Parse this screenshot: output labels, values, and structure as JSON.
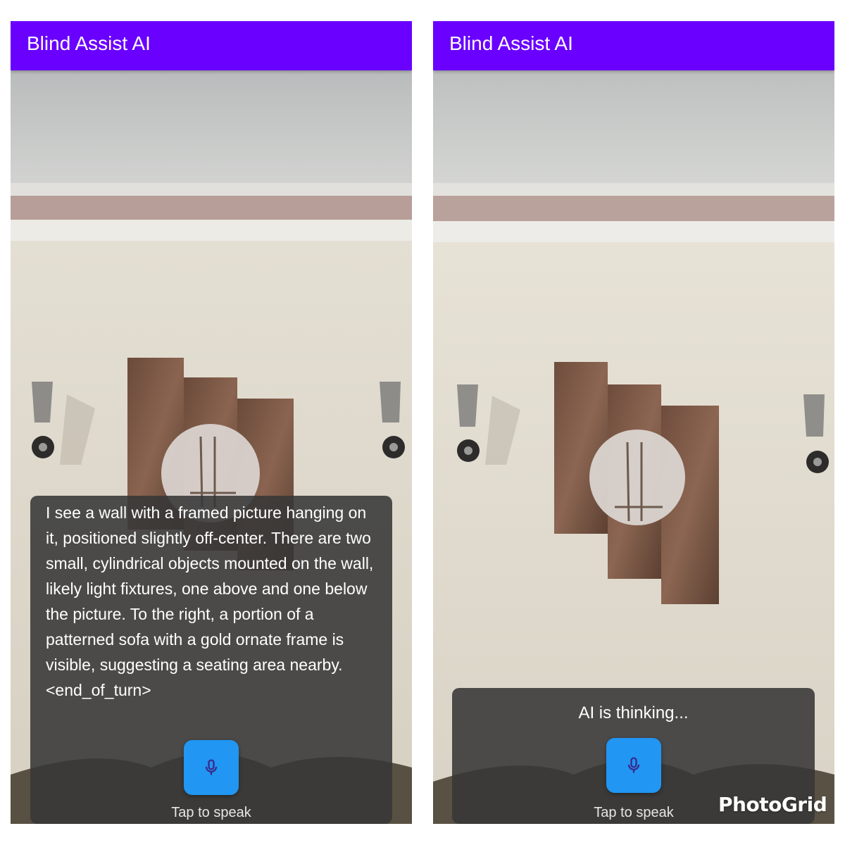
{
  "screens": [
    {
      "app_title": "Blind Assist AI",
      "response_text": "I see a wall with a framed picture hanging on it, positioned slightly off-center. There are two small, cylindrical objects mounted on the wall, likely light fixtures, one above and one below the picture. To the right, a portion of a patterned sofa with a gold ornate frame is visible, suggesting a seating area nearby. <end_of_turn>",
      "mic_icon": "microphone-icon",
      "hint": "Tap to speak"
    },
    {
      "app_title": "Blind Assist AI",
      "status_text": "AI is thinking...",
      "mic_icon": "microphone-icon",
      "hint": "Tap to speak"
    }
  ],
  "watermark": "PhotoGrid",
  "colors": {
    "app_bar": "#6a00ff",
    "mic_button": "#2196f3",
    "overlay": "#373737"
  }
}
